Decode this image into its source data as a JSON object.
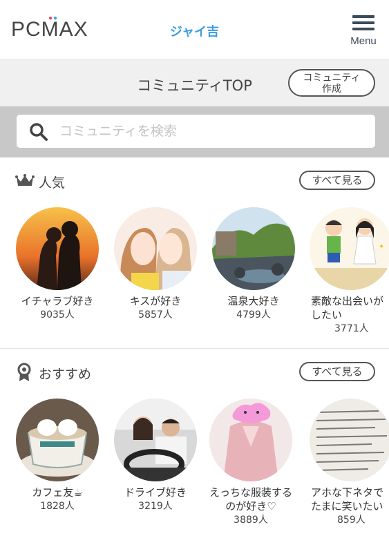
{
  "header": {
    "logo": "PCMAX",
    "username": "ジャイ吉",
    "menu_label": "Menu"
  },
  "title_bar": {
    "title": "コミュニティTOP",
    "create_line1": "コミュニティ",
    "create_line2": "作成"
  },
  "search": {
    "placeholder": "コミュニティを検索",
    "icon": "search-icon"
  },
  "popular": {
    "title": "人気",
    "icon": "crown-icon",
    "see_all": "すべて見る",
    "items": [
      {
        "name": "イチャラブ好き",
        "count": "9035人"
      },
      {
        "name": "キスが好き",
        "count": "5857人"
      },
      {
        "name": "温泉大好き",
        "count": "4799人"
      },
      {
        "name": "素敵な出会いがしたい",
        "count": "3771人"
      }
    ]
  },
  "recommended": {
    "title": "おすすめ",
    "icon": "badge-icon",
    "see_all": "すべて見る",
    "items": [
      {
        "name": "カフェ友☕",
        "count": "1828人"
      },
      {
        "name": "ドライブ好き",
        "count": "3219人"
      },
      {
        "name": "えっちな服装するのが好き♡",
        "count": "3889人"
      },
      {
        "name": "アホな下ネタでたまに笑いたい",
        "count": "859人"
      }
    ]
  },
  "colors": {
    "accent_blue": "#3a9ee6",
    "logo_dot_red": "#e8455a",
    "logo_dot_blue": "#3aa0e8"
  }
}
